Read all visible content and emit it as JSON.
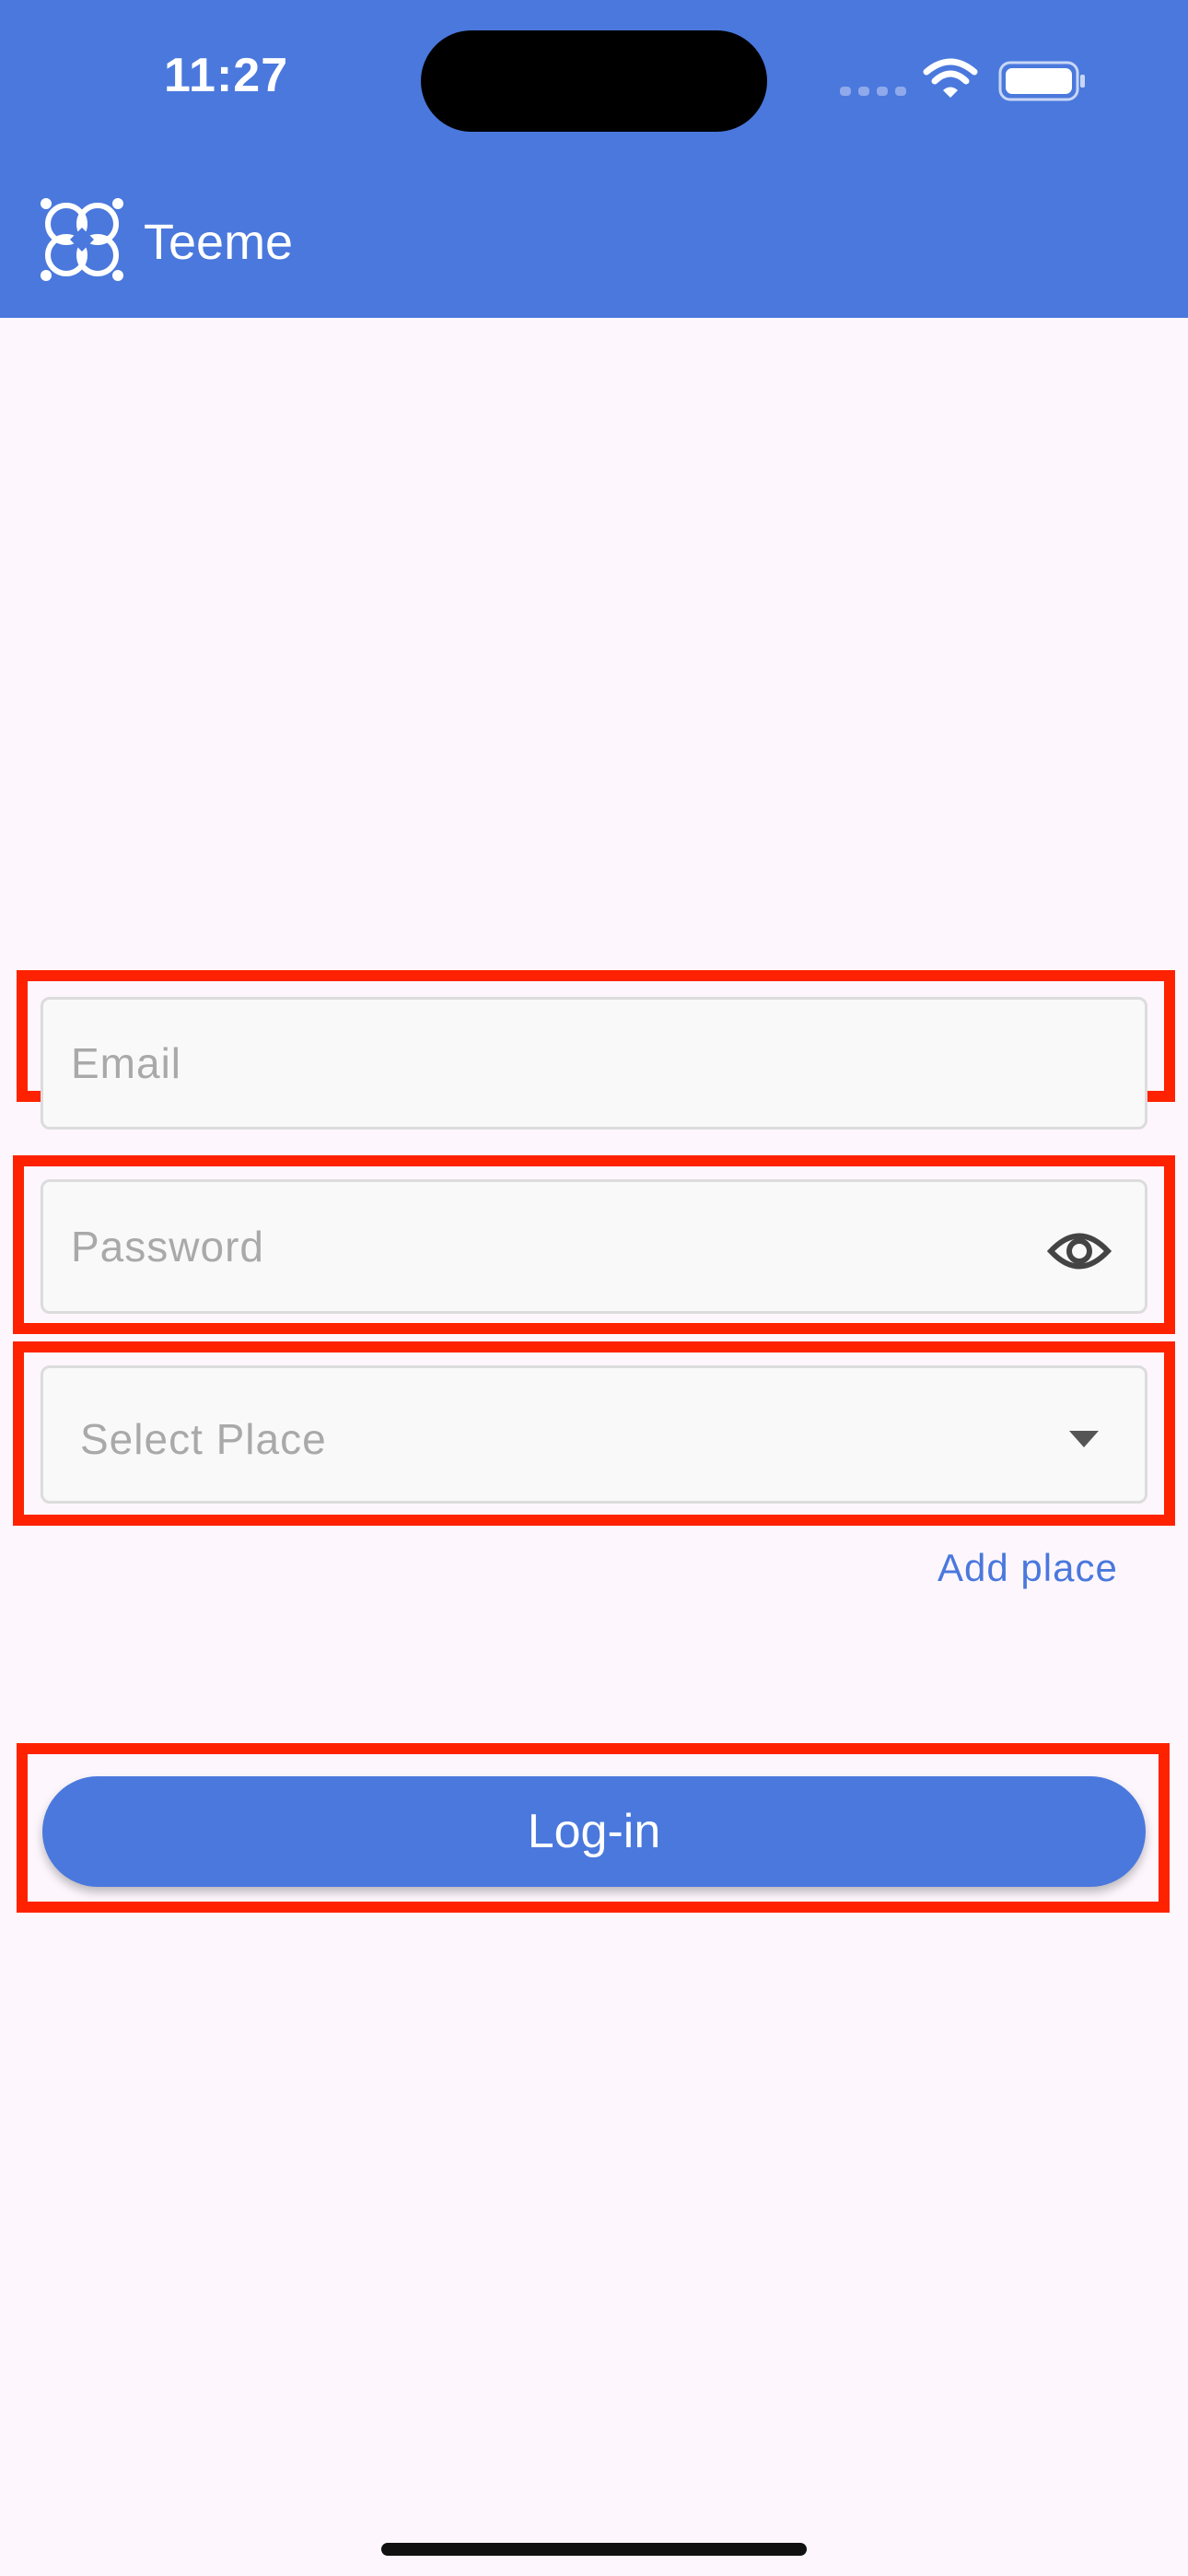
{
  "status_bar": {
    "time": "11:27",
    "icons": [
      "cellular-signal-icon",
      "wifi-icon",
      "battery-icon"
    ]
  },
  "app_bar": {
    "title": "Teeme",
    "logo_icon": "clover-logo-icon",
    "background": "#4a78dd"
  },
  "form": {
    "email": {
      "value": "",
      "placeholder": "Email"
    },
    "password": {
      "value": "",
      "placeholder": "Password",
      "toggle_icon": "eye-icon"
    },
    "place": {
      "placeholder": "Select Place",
      "icon": "dropdown-arrow-icon"
    },
    "add_place_label": "Add place",
    "login_label": "Log-in"
  },
  "colors": {
    "accent": "#4a78dd",
    "highlight": "#ff2200",
    "background": "#fdf7fd"
  }
}
